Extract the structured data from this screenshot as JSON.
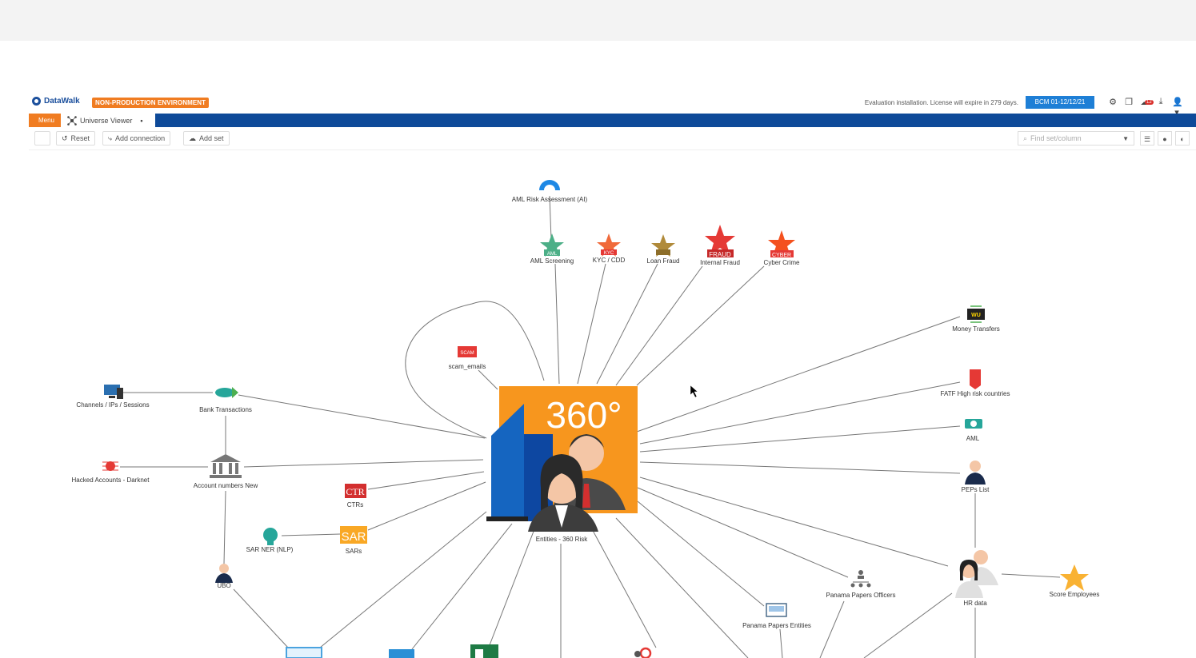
{
  "header": {
    "logo_text": "DataWalk",
    "env_badge": "NON-PRODUCTION ENVIRONMENT",
    "license_text": "Evaluation installation. License will expire in 279 days.",
    "bcm_label": "BCM 01-12/12/21",
    "notification_count": "12",
    "icons": [
      "settings-icon",
      "copy-icon",
      "notification-icon",
      "download-icon",
      "user-icon"
    ]
  },
  "tabs": {
    "menu_label": "Menu",
    "viewer_label": "Universe Viewer",
    "viewer_marker": "•"
  },
  "toolbar": {
    "reset_label": "Reset",
    "add_connection_label": "Add connection",
    "add_set_label": "Add set",
    "search_placeholder": "Find set/column"
  },
  "graph": {
    "center": {
      "label": "Entities - 360 Risk",
      "badge": "360°",
      "colors": {
        "bg": "#f7961e",
        "building": "#1565c0"
      }
    },
    "nodes": {
      "aml_risk": "AML Risk Assessment (AI)",
      "aml_screening": "AML Screening",
      "kyc": "KYC / CDD",
      "loan_fraud": "Loan Fraud",
      "internal_fraud": "Internal Fraud",
      "cyber_crime": "Cyber Crime",
      "money_transfers": "Money Transfers",
      "fatf": "FATF High risk countries",
      "aml": "AML",
      "peps": "PEPs List",
      "hr_data": "HR data",
      "score_employees": "Score Employees",
      "panama_officers": "Panama Papers Officers",
      "panama_entities": "Panama Papers Entities",
      "scam_emails": "scam_emails",
      "channels": "Channels / IPs / Sessions",
      "bank_transactions": "Bank Transactions",
      "hacked_accounts": "Hacked Accounts - Darknet",
      "account_numbers": "Account numbers New",
      "ctrs": "CTRs",
      "sars": "SARs",
      "sar_ner": "SAR NER (NLP)",
      "ubo": "UBO"
    },
    "badges": {
      "aml_screening": "AML",
      "kyc": "KYC",
      "internal_fraud": "FRAUD",
      "cyber_crime": "CYBER",
      "ctrs": "CTR",
      "sars": "SAR",
      "money_transfers": "WU",
      "scam": "SCAM"
    }
  }
}
